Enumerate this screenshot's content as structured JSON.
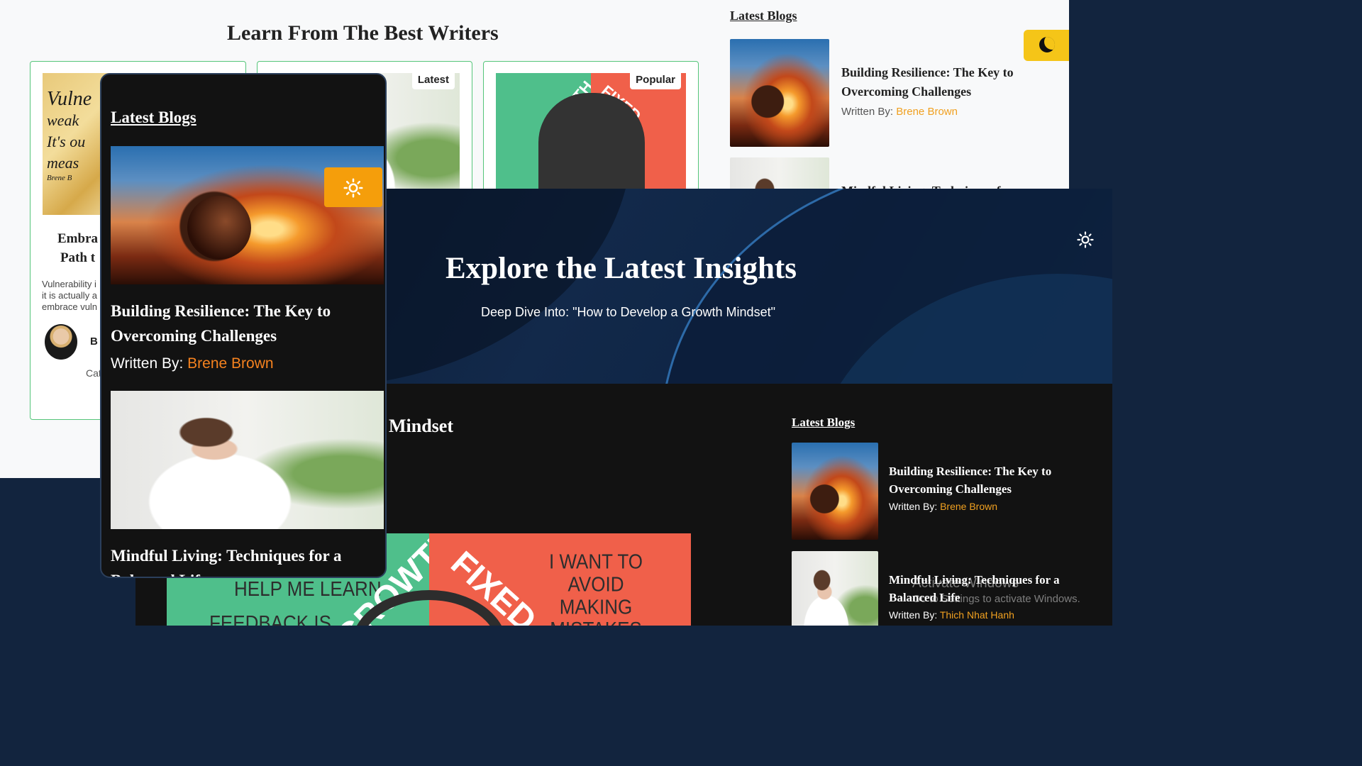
{
  "light_page": {
    "section_title": "Learn From The Best Writers",
    "cards": [
      {
        "image_text": [
          "Vulne",
          "weak",
          "It's ou",
          "meas",
          "Brene B"
        ],
        "title_lines": [
          "Embra",
          "Path t"
        ],
        "excerpt_lines": [
          "Vulnerability i",
          "it is actually a",
          "embrace vuln"
        ],
        "author_fragment": "B",
        "category_fragment": "Cat"
      },
      {
        "badge": "Latest"
      },
      {
        "badge": "Popular",
        "image_words": [
          "GROWTH",
          "FIXED"
        ]
      }
    ],
    "sidebar": {
      "heading": "Latest Blogs",
      "items": [
        {
          "title": "Building Resilience: The Key to Overcoming Challenges",
          "written_by": "Written By:",
          "author": "Brene Brown"
        },
        {
          "title_fragment": "Mindful Living: Techniques for a"
        }
      ]
    },
    "theme_toggle_icon": "moon-icon"
  },
  "dark_page": {
    "hero_title": "Explore the Latest Insights",
    "hero_subtitle": "Deep Dive Into: \"How to Develop a Growth Mindset\"",
    "theme_toggle_icon": "sun-icon",
    "post_heading_fragment": "Mindset",
    "post_image_text": {
      "left": [
        "HELP ME LEARN",
        "FEEDBACK IS"
      ],
      "center": [
        "GROWTH",
        "FIXED"
      ],
      "right": [
        "I WANT TO",
        "AVOID MAKING",
        "MISTAKES"
      ]
    },
    "sidebar": {
      "heading": "Latest Blogs",
      "items": [
        {
          "title": "Building Resilience: The Key to Overcoming Challenges",
          "written_by": "Written By:",
          "author": "Brene Brown"
        },
        {
          "title": "Mindful Living: Techniques for a Balanced Life",
          "written_by": "Written By:",
          "author": "Thich Nhat Hanh"
        }
      ]
    },
    "watermark": {
      "line1": "Activate Windows",
      "line2": "Go to Settings to activate Windows."
    }
  },
  "mobile_view": {
    "heading": "Latest Blogs",
    "theme_toggle_icon": "sun-icon",
    "items": [
      {
        "title": "Building Resilience: The Key to Overcoming Challenges",
        "written_by": "Written By:",
        "author": "Brene Brown"
      },
      {
        "title": "Mindful Living: Techniques for a Balanced Life"
      }
    ]
  },
  "colors": {
    "accent_green": "#55c57a",
    "accent_gold": "#f5c518",
    "accent_orange": "#f59e0b",
    "author_link": "#f0a020",
    "dark_bg": "#121212",
    "hero_navy": "#12294a"
  }
}
